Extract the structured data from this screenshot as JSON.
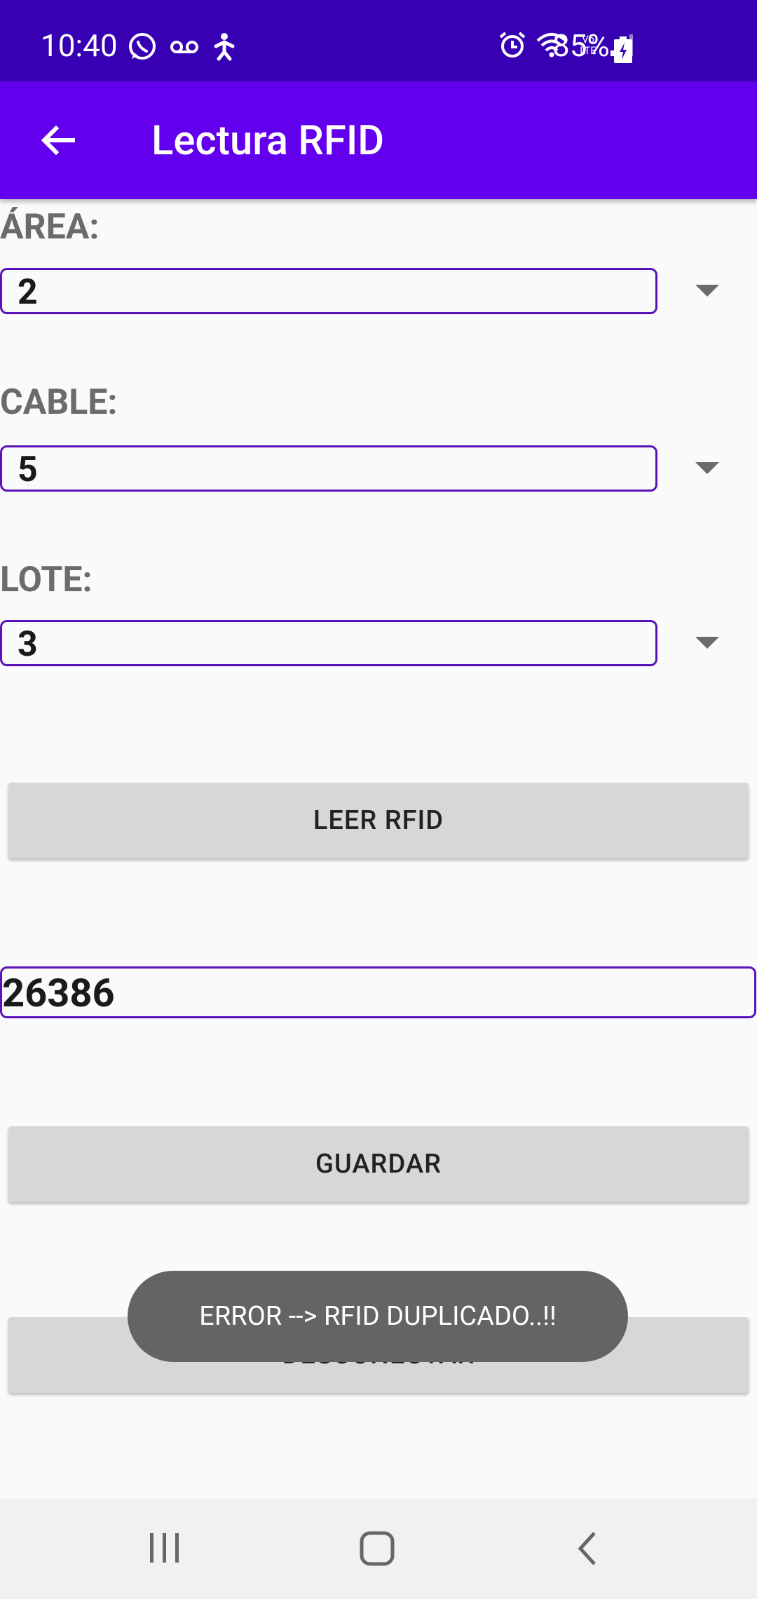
{
  "status_bar": {
    "time": "10:40",
    "battery": "85%",
    "icons_left": [
      "whatsapp-icon",
      "voicemail-icon",
      "accessibility-icon"
    ],
    "icons_right": [
      "alarm-icon",
      "wifi-icon",
      "volte-icon",
      "signal-icon",
      "battery-charging-icon"
    ],
    "volte_text": "Vo LTE"
  },
  "app_bar": {
    "title": "Lectura RFID",
    "back_icon": "arrow-back-icon"
  },
  "colors": {
    "status_bar": "#3700b3",
    "app_bar": "#6200ee",
    "field_border": "#5b13b9",
    "button_bg": "#d6d7d7",
    "toast_bg": "#646464",
    "background": "#fafafa"
  },
  "form": {
    "area": {
      "label": "ÁREA:",
      "value": "2"
    },
    "cable": {
      "label": "CABLE:",
      "value": "5"
    },
    "lote": {
      "label": "LOTE:",
      "value": "3"
    },
    "read_button": "LEER RFID",
    "rfid_value": "26386",
    "save_button": "GUARDAR",
    "disconnect_button": "DESCONECTAR"
  },
  "toast": {
    "message": "ERROR --> RFID DUPLICADO..!!"
  },
  "nav_bar": {
    "items": [
      "recent-apps-icon",
      "home-icon",
      "back-nav-icon"
    ]
  }
}
